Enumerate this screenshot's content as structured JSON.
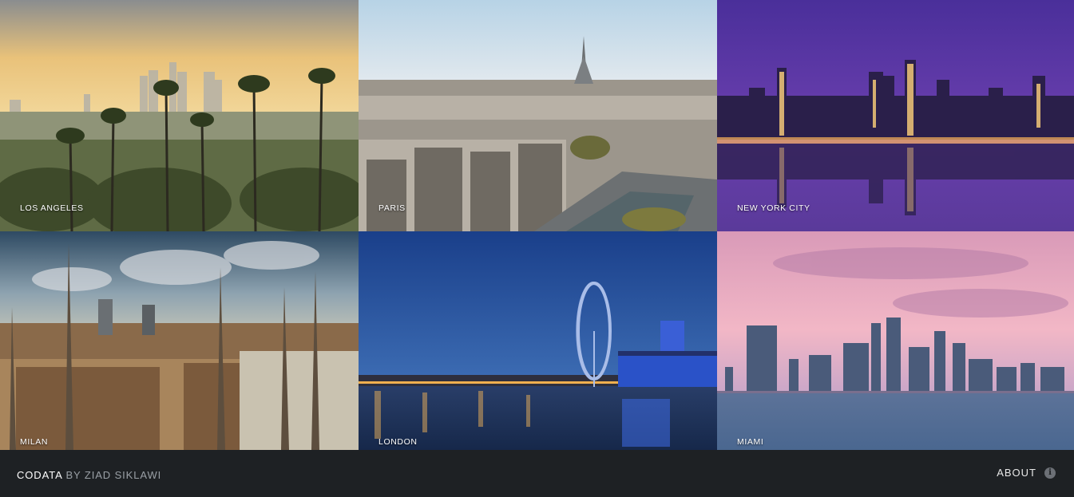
{
  "cities": [
    {
      "label": "LOS ANGELES"
    },
    {
      "label": "PARIS"
    },
    {
      "label": "NEW YORK CITY"
    },
    {
      "label": "MILAN"
    },
    {
      "label": "LONDON"
    },
    {
      "label": "MIAMI"
    }
  ],
  "footer": {
    "brand": "CODATA",
    "byline": "BY ZIAD SIKLAWI",
    "about_label": "ABOUT",
    "info_icon": "i"
  },
  "colors": {
    "footer_bg": "#1e2124",
    "label_text": "#ffffff"
  }
}
